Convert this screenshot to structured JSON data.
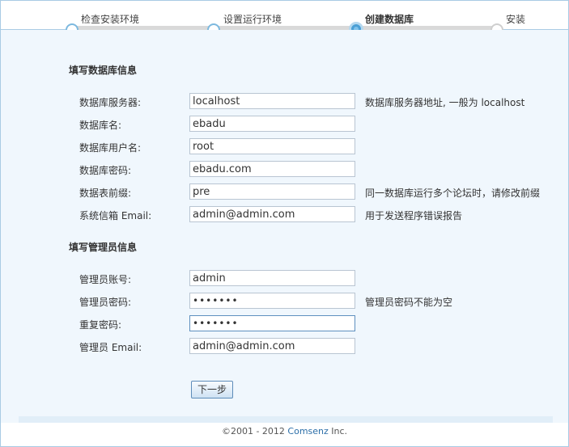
{
  "steps": [
    {
      "label": "检查安装环境",
      "state": "done"
    },
    {
      "label": "设置运行环境",
      "state": "done"
    },
    {
      "label": "创建数据库",
      "state": "current"
    },
    {
      "label": "安装",
      "state": "todo"
    }
  ],
  "db_section": {
    "title": "填写数据库信息",
    "fields": [
      {
        "label": "数据库服务器:",
        "value": "localhost",
        "hint": "数据库服务器地址, 一般为  localhost"
      },
      {
        "label": "数据库名:",
        "value": "ebadu",
        "hint": ""
      },
      {
        "label": "数据库用户名:",
        "value": "root",
        "hint": ""
      },
      {
        "label": "数据库密码:",
        "value": "ebadu.com",
        "hint": ""
      },
      {
        "label": "数据表前缀:",
        "value": "pre",
        "hint": "同一数据库运行多个论坛时，请修改前缀"
      },
      {
        "label": "系统信箱  Email:",
        "value": "admin@admin.com",
        "hint": "用于发送程序错误报告"
      }
    ]
  },
  "admin_section": {
    "title": "填写管理员信息",
    "fields": [
      {
        "label": "管理员账号:",
        "value": "admin",
        "hint": ""
      },
      {
        "label": "管理员密码:",
        "value": "•••••••",
        "hint": "管理员密码不能为空"
      },
      {
        "label": "重复密码:",
        "value": "•••••••",
        "hint": ""
      },
      {
        "label": "管理员  Email:",
        "value": "admin@admin.com",
        "hint": ""
      }
    ]
  },
  "next_button": "下一步",
  "footer": {
    "prefix": "©2001 - 2012 ",
    "brand": "Comsenz",
    "suffix": " Inc."
  },
  "colors": {
    "accent": "#4a9fd5",
    "border": "#a9cbe4",
    "content_bg": "#f0f7fd"
  }
}
